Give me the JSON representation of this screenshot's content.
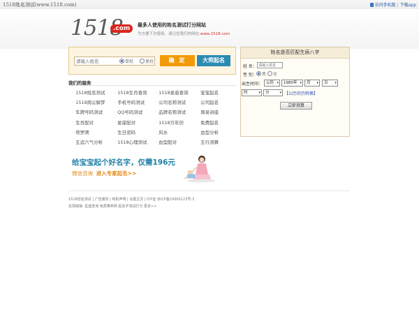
{
  "topbar": {
    "site_title": "1518姓名测试(www.1518.com)",
    "mobile_link": "访问手机版",
    "download_link": "下载app"
  },
  "header": {
    "logo_number": "1518",
    "logo_suffix": ".com",
    "slogan": "最多人使用的姓名测试打分网站",
    "subslogan_prefix": "为方便下次使用，请记住我们的网址:",
    "subslogan_url": "www.1518.com"
  },
  "search": {
    "name_placeholder": "请输入姓名",
    "radio_single": "单姓",
    "radio_double": "复姓",
    "radio_selected": "单姓",
    "confirm_label": "确 定",
    "master_label": "大师起名"
  },
  "services": {
    "title": "我们的服务",
    "items": [
      "1518姓名测试",
      "1518生肖查询",
      "1518星座查询",
      "宝宝起名",
      "1518周公解梦",
      "手机号码测试",
      "公司名称测试",
      "公司起名",
      "车牌号码测试",
      "QQ号码测试",
      "品牌名称测试",
      "周易讲座",
      "生肖配对",
      "星座配对",
      "1518万年历",
      "免费起名",
      "塔罗牌",
      "生日密码",
      "风水",
      "血型分析",
      "五运六气分析",
      "1518心理测试",
      "血型配对",
      "五行测算"
    ]
  },
  "bazi": {
    "title": "姓名是否匹配生辰八字",
    "name_label": "姓  名：",
    "name_placeholder": "请输入姓名",
    "gender_label": "性  别：",
    "gender_male": "男",
    "gender_female": "女",
    "gender_selected": "男",
    "birth_label": "出生时间：",
    "calendar_value": "公历",
    "year_value": "1980年",
    "month_value": "月",
    "day_value": "日",
    "hour_value": "时",
    "minute_value": "分",
    "convert_link": "【公历农历转换】",
    "calc_button": "立即测算"
  },
  "banner": {
    "main_text": "给宝宝起个好名字，仅需196元",
    "sub_text_a": "微信咨询",
    "sub_text_b": "进入专家起名>>"
  },
  "footer": {
    "line1": "1518姓名测试 | 广告服务 | 特别声明 | 设置主页 | ICP证:京ICP备10000123号-3",
    "line2": "友情链接: 星座查询 免费算命网 起名字测试打分 更多>>"
  },
  "colors": {
    "accent_orange": "#f29b0a",
    "accent_blue": "#2c8bb3",
    "brand_red": "#d9261c",
    "link_blue": "#2a4fb5"
  }
}
